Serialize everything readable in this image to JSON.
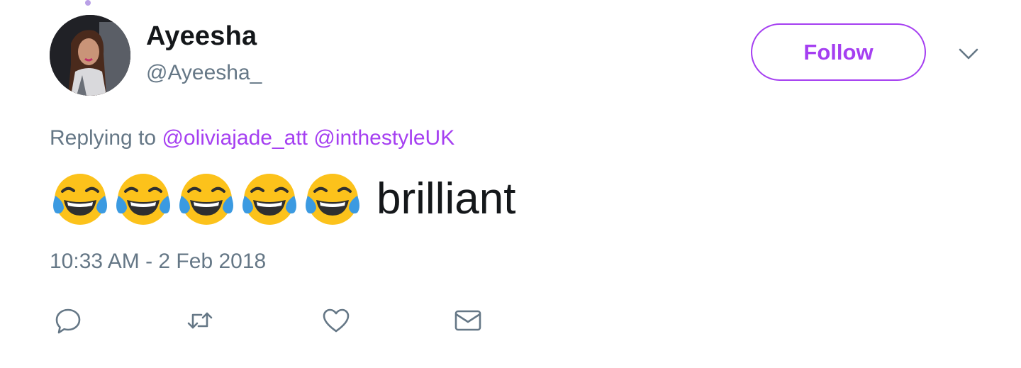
{
  "user": {
    "display_name": "Ayeesha",
    "handle": "@Ayeesha_"
  },
  "follow_button": {
    "label": "Follow"
  },
  "reply": {
    "prefix": "Replying to",
    "mentions": [
      "@oliviajade_att",
      "@inthestyleUK"
    ]
  },
  "tweet": {
    "emojis": [
      "face-with-tears-of-joy",
      "face-with-tears-of-joy",
      "face-with-tears-of-joy",
      "face-with-tears-of-joy",
      "face-with-tears-of-joy"
    ],
    "text": "brilliant",
    "timestamp": "10:33 AM - 2 Feb 2018"
  },
  "actions": [
    "reply-icon",
    "retweet-icon",
    "like-icon",
    "direct-message-icon"
  ],
  "colors": {
    "accent": "#a53ff1",
    "secondary_text": "#657786",
    "primary_text": "#14171a"
  }
}
